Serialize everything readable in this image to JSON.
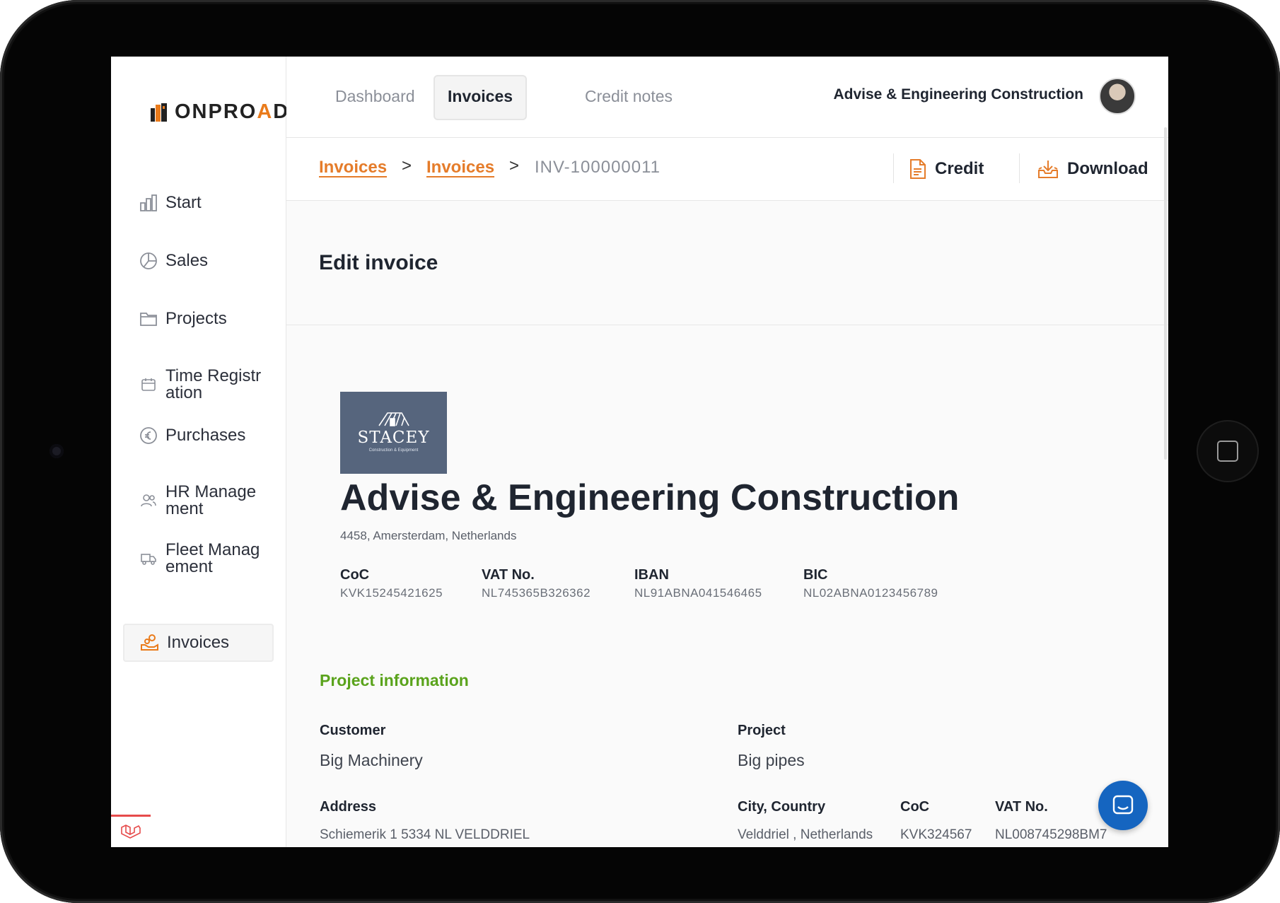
{
  "app": {
    "logo_text_a": "ONPRO",
    "logo_text_b": "A",
    "logo_text_c": "D",
    "brand_color": "#ea7b1b"
  },
  "sidebar": {
    "items": [
      {
        "label": "Start",
        "icon": "bar-chart-icon"
      },
      {
        "label": "Sales",
        "icon": "pie-chart-icon"
      },
      {
        "label": "Projects",
        "icon": "folder-icon"
      },
      {
        "label": "Time Registr ation",
        "icon": "calendar-icon"
      },
      {
        "label": "Purchases",
        "icon": "euro-icon"
      },
      {
        "label": "HR Manage ment",
        "icon": "users-icon"
      },
      {
        "label": "Fleet Manag ement",
        "icon": "truck-icon"
      },
      {
        "label": "Invoices",
        "icon": "hand-coins-icon",
        "active": true
      }
    ]
  },
  "topbar": {
    "tabs": [
      {
        "label": "Dashboard"
      },
      {
        "label": "Invoices",
        "active": true
      },
      {
        "label": "Credit notes"
      }
    ],
    "company_name": "Advise & Engineering Construction"
  },
  "breadcrumb": {
    "items": [
      "Invoices",
      "Invoices"
    ],
    "separator": ">",
    "current": "INV-100000011",
    "credit_label": "Credit",
    "download_label": "Download"
  },
  "page": {
    "title": "Edit invoice"
  },
  "company": {
    "logo_name": "STACEY",
    "logo_sub": "Construction & Equipment",
    "name": "Advise & Engineering Construction",
    "address": "4458, Amersterdam, Netherlands",
    "registration": [
      {
        "label": "CoC",
        "value": "KVK15245421625"
      },
      {
        "label": "VAT No.",
        "value": "NL745365B326362"
      },
      {
        "label": "IBAN",
        "value": "NL91ABNA041546465"
      },
      {
        "label": "BIC",
        "value": "NL02ABNA0123456789"
      }
    ]
  },
  "project_info": {
    "title": "Project information",
    "customer_label": "Customer",
    "customer_value": "Big Machinery",
    "project_label": "Project",
    "project_value": "Big pipes",
    "address_label": "Address",
    "address_value": "Schiemerik 1 5334 NL VELDDRIEL",
    "city_label": "City, Country",
    "city_value": "Velddriel , Netherlands",
    "coc_label": "CoC",
    "coc_value": "KVK324567",
    "vat_label": "VAT No.",
    "vat_value": "NL008745298BM7"
  },
  "colors": {
    "accent_orange": "#e57c2a",
    "section_green": "#5aa31c",
    "chat_blue": "#1565c0"
  }
}
